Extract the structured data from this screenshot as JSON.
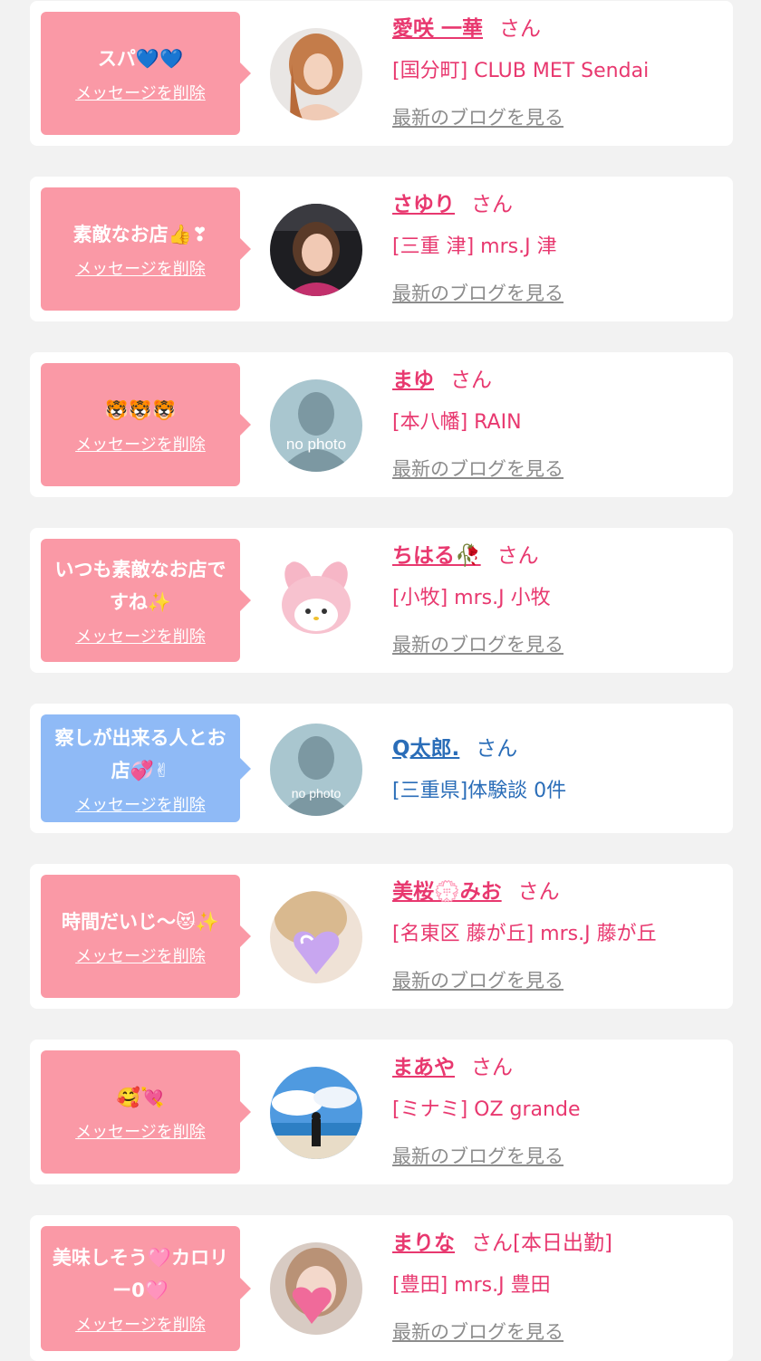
{
  "cards": [
    {
      "message": "スパ💙💙",
      "delete_label": "メッセージを削除",
      "name": "愛咲 一華",
      "suffix": "さん",
      "shop": "[国分町] CLUB MET Sendai",
      "blog_link": "最新のブログを見る",
      "avatar": "photo-woman-1",
      "bubble_color": "#fa99a6"
    },
    {
      "message": "素敵なお店👍❣",
      "delete_label": "メッセージを削除",
      "name": "さゆり",
      "suffix": "さん",
      "shop": "[三重 津] mrs.J 津",
      "blog_link": "最新のブログを見る",
      "avatar": "photo-woman-2",
      "bubble_color": "#fa99a6"
    },
    {
      "message": "🐯🐯🐯",
      "delete_label": "メッセージを削除",
      "name": "まゆ",
      "suffix": "さん",
      "shop": "[本八幡] RAIN",
      "blog_link": "最新のブログを見る",
      "avatar": "no-photo",
      "avatar_text": "no photo",
      "bubble_color": "#fa99a6"
    },
    {
      "message": "いつも素敵なお店ですね✨",
      "delete_label": "メッセージを削除",
      "name": "ちはる🥀",
      "suffix": "さん",
      "shop": "[小牧] mrs.J 小牧",
      "blog_link": "最新のブログを見る",
      "avatar": "plush-toy",
      "bubble_color": "#fa99a6"
    },
    {
      "message": "察しが出来る人とお店💞✌",
      "delete_label": "メッセージを削除",
      "name": "Q太郎.",
      "suffix": "さん",
      "shop": "[三重県]体験談 0件",
      "avatar": "no-photo",
      "avatar_text": "no photo",
      "bubble_color": "#8fbaf6"
    },
    {
      "message": "時間だいじ〜😻✨",
      "delete_label": "メッセージを削除",
      "name": "美桜💮みお",
      "suffix": "さん",
      "shop": "[名東区 藤が丘] mrs.J 藤が丘",
      "blog_link": "最新のブログを見る",
      "avatar": "photo-woman-3",
      "bubble_color": "#fa99a6"
    },
    {
      "message": "🥰💘",
      "delete_label": "メッセージを削除",
      "name": "まあや",
      "suffix": "さん",
      "shop": "[ミナミ] OZ grande",
      "blog_link": "最新のブログを見る",
      "avatar": "photo-beach",
      "bubble_color": "#fa99a6"
    },
    {
      "message": "美味しそう🩷カロリー0🩷",
      "delete_label": "メッセージを削除",
      "name": "まりな",
      "suffix": "さん[本日出勤]",
      "shop": "[豊田] mrs.J 豊田",
      "blog_link": "最新のブログを見る",
      "avatar": "photo-woman-4",
      "bubble_color": "#fa99a6"
    }
  ]
}
